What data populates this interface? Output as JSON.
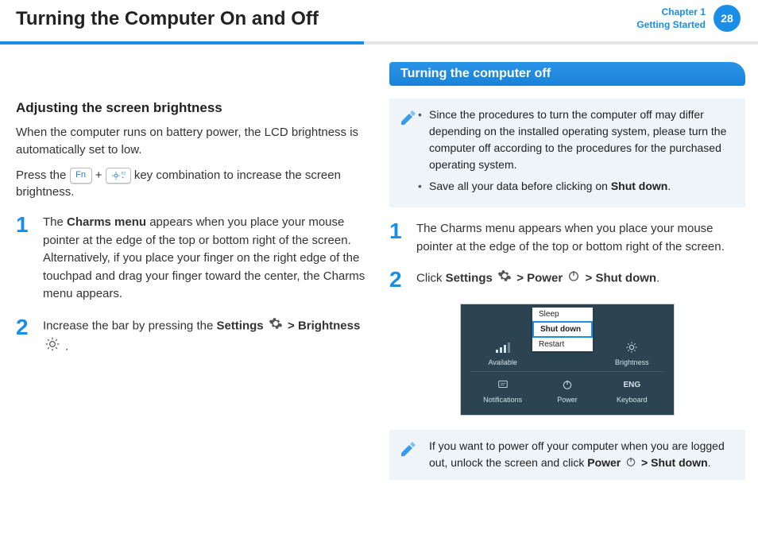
{
  "header": {
    "title": "Turning the Computer On and Off",
    "chapter_line1": "Chapter 1",
    "chapter_line2": "Getting Started",
    "page_number": "28"
  },
  "left": {
    "subhead": "Adjusting the screen brightness",
    "intro": "When the computer runs on battery power, the LCD brightness is automatically set to low.",
    "press_pre": "Press the ",
    "key_fn": "Fn",
    "plus": " + ",
    "key_f3": "F3",
    "press_post": " key combination to increase the screen brightness.",
    "step1_num": "1",
    "step1_pre": "The ",
    "step1_bold": "Charms menu",
    "step1_post": " appears when you place your mouse pointer at the edge of the top or bottom right of the screen. Alternatively, if you place your finger on the right edge of the touchpad and drag your finger toward the center, the Charms menu appears.",
    "step2_num": "2",
    "step2_pre": "Increase the bar by pressing the ",
    "step2_settings": "Settings",
    "step2_sep": " > ",
    "step2_brightness": "Brightness",
    "step2_end": " ."
  },
  "right": {
    "banner": "Turning the computer off",
    "note1_a": "Since the procedures to turn the computer off may differ depending on the installed operating system, please turn the computer off according to the procedures for the purchased operating system.",
    "note1_b_pre": "Save all your data before clicking on ",
    "note1_b_bold": "Shut down",
    "note1_b_post": ".",
    "step1_num": "1",
    "step1_text": "The Charms menu appears when you place your mouse pointer at the edge of the top or bottom right of the screen.",
    "step2_num": "2",
    "step2_pre": "Click ",
    "step2_settings": "Settings",
    "step2_sep1": " > ",
    "step2_power": "Power",
    "step2_sep2": " > ",
    "step2_shutdown": "Shut down",
    "step2_end": ".",
    "note2_pre": "If you want to power off your computer when you are logged out, unlock the screen and click ",
    "note2_power": "Power",
    "note2_sep": " > ",
    "note2_shutdown": "Shut down",
    "note2_end": "."
  },
  "charms": {
    "popup_sleep": "Sleep",
    "popup_shutdown": "Shut down",
    "popup_restart": "Restart",
    "row1_available": "Available",
    "row1_brightness": "Brightness",
    "row2_notifications": "Notifications",
    "row2_power": "Power",
    "row2_keyboard_lang": "ENG",
    "row2_keyboard": "Keyboard"
  }
}
